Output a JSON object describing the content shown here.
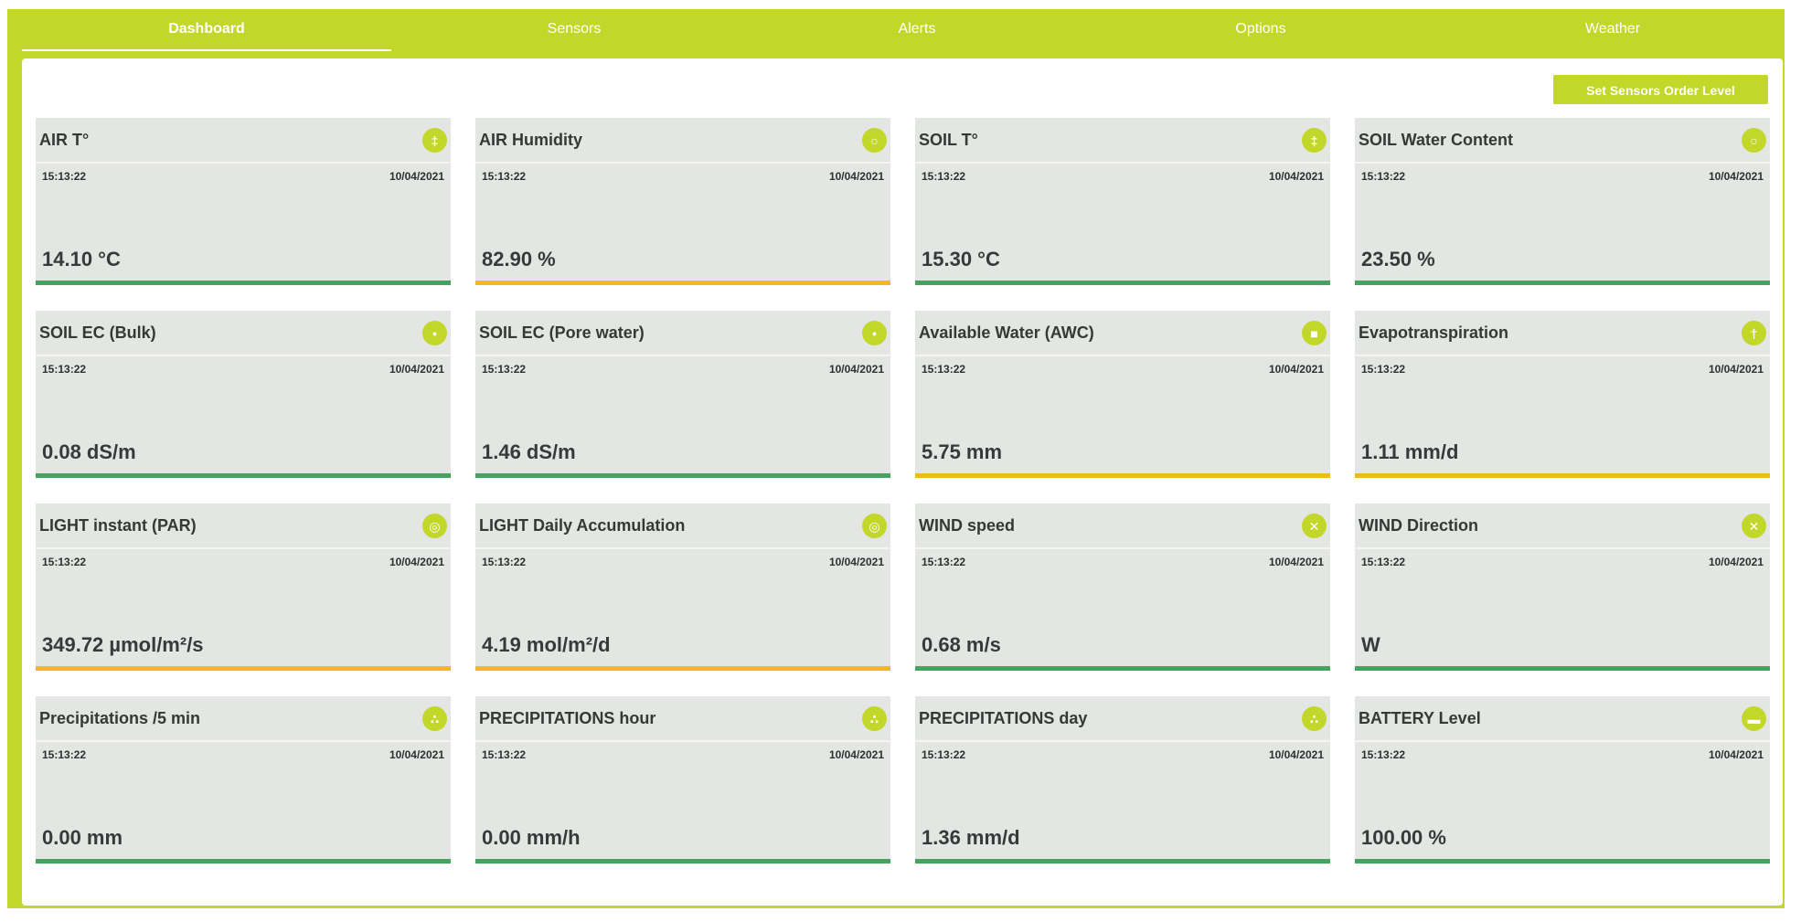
{
  "colors": {
    "brand": "#c2d72a",
    "ok": "#44a35e",
    "warning": "#f2b823",
    "card_bg": "#e4e6e3"
  },
  "nav": {
    "tabs": [
      {
        "label": "Dashboard",
        "active": true
      },
      {
        "label": "Sensors",
        "active": false
      },
      {
        "label": "Alerts",
        "active": false
      },
      {
        "label": "Options",
        "active": false
      },
      {
        "label": "Weather",
        "active": false
      }
    ]
  },
  "toolbar": {
    "order_button_label": "Set Sensors Order Level"
  },
  "cards": [
    {
      "title": "AIR T°",
      "time": "15:13:22",
      "date": "10/04/2021",
      "value": "14.10 °C",
      "icon": "thermometer-icon",
      "status": "ok"
    },
    {
      "title": "AIR Humidity",
      "time": "15:13:22",
      "date": "10/04/2021",
      "value": "82.90 %",
      "icon": "drop-icon",
      "status": "warning"
    },
    {
      "title": "SOIL T°",
      "time": "15:13:22",
      "date": "10/04/2021",
      "value": "15.30 °C",
      "icon": "thermometer-icon",
      "status": "ok"
    },
    {
      "title": "SOIL Water Content",
      "time": "15:13:22",
      "date": "10/04/2021",
      "value": "23.50 %",
      "icon": "drop-icon",
      "status": "ok"
    },
    {
      "title": "SOIL EC (Bulk)",
      "time": "15:13:22",
      "date": "10/04/2021",
      "value": "0.08 dS/m",
      "icon": "conductivity-icon",
      "status": "ok"
    },
    {
      "title": "SOIL EC (Pore water)",
      "time": "15:13:22",
      "date": "10/04/2021",
      "value": "1.46 dS/m",
      "icon": "conductivity-icon",
      "status": "ok"
    },
    {
      "title": "Available Water (AWC)",
      "time": "15:13:22",
      "date": "10/04/2021",
      "value": "5.75 mm",
      "icon": "water-tank-icon",
      "status": "warning"
    },
    {
      "title": "Evapotranspiration",
      "time": "15:13:22",
      "date": "10/04/2021",
      "value": "1.11 mm/d",
      "icon": "plant-icon",
      "status": "warning"
    },
    {
      "title": "LIGHT instant (PAR)",
      "time": "15:13:22",
      "date": "10/04/2021",
      "value": "349.72 µmol/m²/s",
      "icon": "light-icon",
      "status": "warning"
    },
    {
      "title": "LIGHT Daily Accumulation",
      "time": "15:13:22",
      "date": "10/04/2021",
      "value": "4.19 mol/m²/d",
      "icon": "light-icon",
      "status": "warning"
    },
    {
      "title": "WIND speed",
      "time": "15:13:22",
      "date": "10/04/2021",
      "value": "0.68 m/s",
      "icon": "wind-icon",
      "status": "ok"
    },
    {
      "title": "WIND Direction",
      "time": "15:13:22",
      "date": "10/04/2021",
      "value": "W",
      "icon": "wind-icon",
      "status": "ok"
    },
    {
      "title": "Precipitations /5 min",
      "time": "15:13:22",
      "date": "10/04/2021",
      "value": "0.00 mm",
      "icon": "rain-icon",
      "status": "ok"
    },
    {
      "title": "PRECIPITATIONS hour",
      "time": "15:13:22",
      "date": "10/04/2021",
      "value": "0.00 mm/h",
      "icon": "rain-icon",
      "status": "ok"
    },
    {
      "title": "PRECIPITATIONS day",
      "time": "15:13:22",
      "date": "10/04/2021",
      "value": "1.36 mm/d",
      "icon": "rain-icon",
      "status": "ok"
    },
    {
      "title": "BATTERY Level",
      "time": "15:13:22",
      "date": "10/04/2021",
      "value": "100.00 %",
      "icon": "battery-icon",
      "status": "ok"
    }
  ]
}
